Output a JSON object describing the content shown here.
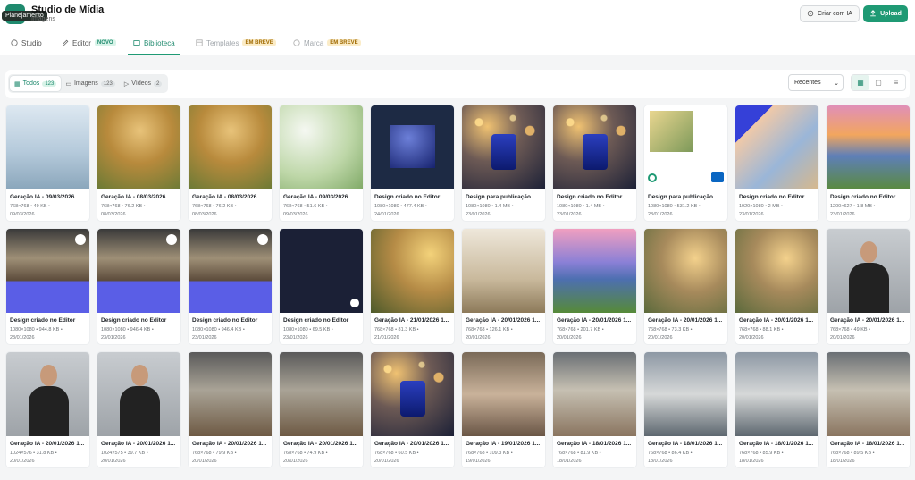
{
  "app": {
    "title": "Studio de Mídia",
    "subtitle": "Imagens",
    "tooltip": "Planejamento"
  },
  "header": {
    "ai_button": "Criar com IA",
    "upload_button": "Upload"
  },
  "tabs": [
    {
      "label": "Studio",
      "icon": "palette-icon",
      "badge": ""
    },
    {
      "label": "Editor",
      "icon": "edit-icon",
      "badge": "NOVO"
    },
    {
      "label": "Biblioteca",
      "icon": "library-icon",
      "badge": ""
    },
    {
      "label": "Templates",
      "icon": "templates-icon",
      "badge": "EM BREVE"
    },
    {
      "label": "Marca",
      "icon": "brand-icon",
      "badge": "EM BREVE"
    }
  ],
  "filters": {
    "all": {
      "label": "Todos",
      "count": "123"
    },
    "images": {
      "label": "Imagens",
      "count": "123"
    },
    "videos": {
      "label": "Vídeos",
      "count": "2"
    },
    "sort": "Recentes"
  },
  "colors": {
    "accent": "#1f9a74",
    "badge_new_bg": "#d8f3e8",
    "badge_soon_bg": "#fbecc8"
  },
  "cards": [
    {
      "title": "Geração IA - 09/03/2026 ...",
      "meta": "768×768 • 49 KB •",
      "date": "09/03/2026",
      "thumb": "t-bottle"
    },
    {
      "title": "Geração IA - 08/03/2026 ...",
      "meta": "768×768 • 76.2 KB •",
      "date": "08/03/2026",
      "thumb": "t-dog"
    },
    {
      "title": "Geração IA - 08/03/2026 ...",
      "meta": "768×768 • 76.2 KB •",
      "date": "08/03/2026",
      "thumb": "t-dog"
    },
    {
      "title": "Geração IA - 09/03/2026 ...",
      "meta": "768×768 • 51.6 KB •",
      "date": "09/03/2026",
      "thumb": "t-perfume-green"
    },
    {
      "title": "Design criado no Editor",
      "meta": "1080×1080 • 477.4 KB •",
      "date": "24/01/2026",
      "thumb": "t-editor-dark"
    },
    {
      "title": "Design para publicação",
      "meta": "1080×1080 • 1.4 MB •",
      "date": "23/01/2026",
      "thumb": "t-perfume-blue"
    },
    {
      "title": "Design criado no Editor",
      "meta": "1080×1080 • 1.4 MB •",
      "date": "23/01/2026",
      "thumb": "t-perfume-blue"
    },
    {
      "title": "Design para publicação",
      "meta": "1080×1080 • 531.2 KB •",
      "date": "23/01/2026",
      "thumb": "t-linkedin"
    },
    {
      "title": "Design criado no Editor",
      "meta": "1920×1080 • 2 MB •",
      "date": "23/01/2026",
      "thumb": "t-beach"
    },
    {
      "title": "Design criado no Editor",
      "meta": "1200×627 • 1.8 MB •",
      "date": "23/01/2026",
      "thumb": "t-house"
    },
    {
      "title": "Design criado no Editor",
      "meta": "1080×1080 • 944.8 KB •",
      "date": "23/01/2026",
      "thumb": "t-lab"
    },
    {
      "title": "Design criado no Editor",
      "meta": "1080×1080 • 946.4 KB •",
      "date": "23/01/2026",
      "thumb": "t-lab"
    },
    {
      "title": "Design criado no Editor",
      "meta": "1080×1080 • 946.4 KB •",
      "date": "23/01/2026",
      "thumb": "t-lab"
    },
    {
      "title": "Design criado no Editor",
      "meta": "1080×1080 • 69.5 KB •",
      "date": "23/01/2026",
      "thumb": "t-lab-dark"
    },
    {
      "title": "Geração IA - 21/01/2026 1...",
      "meta": "768×768 • 81.3 KB •",
      "date": "21/01/2026",
      "thumb": "t-girl-dog"
    },
    {
      "title": "Geração IA - 20/01/2026 1...",
      "meta": "768×768 • 126.1 KB •",
      "date": "20/01/2026",
      "thumb": "t-interior"
    },
    {
      "title": "Geração IA - 20/01/2026 1...",
      "meta": "768×768 • 201.7 KB •",
      "date": "20/01/2026",
      "thumb": "t-house2"
    },
    {
      "title": "Geração IA - 20/01/2026 1...",
      "meta": "768×768 • 73.3 KB •",
      "date": "20/01/2026",
      "thumb": "t-couple"
    },
    {
      "title": "Geração IA - 20/01/2026 1...",
      "meta": "768×768 • 88.1 KB •",
      "date": "20/01/2026",
      "thumb": "t-couple"
    },
    {
      "title": "Geração IA - 20/01/2026 1...",
      "meta": "768×768 • 49 KB •",
      "date": "20/01/2026",
      "thumb": "t-man"
    },
    {
      "title": "Geração IA - 20/01/2026 1...",
      "meta": "1024×576 • 31.8 KB •",
      "date": "20/01/2026",
      "thumb": "t-man"
    },
    {
      "title": "Geração IA - 20/01/2026 1...",
      "meta": "1024×575 • 39.7 KB •",
      "date": "20/01/2026",
      "thumb": "t-man"
    },
    {
      "title": "Geração IA - 20/01/2026 1...",
      "meta": "768×768 • 79.9 KB •",
      "date": "20/01/2026",
      "thumb": "t-office"
    },
    {
      "title": "Geração IA - 20/01/2026 1...",
      "meta": "768×768 • 74.9 KB •",
      "date": "20/01/2026",
      "thumb": "t-office"
    },
    {
      "title": "Geração IA - 20/01/2026 1...",
      "meta": "768×768 • 60.5 KB •",
      "date": "20/01/2026",
      "thumb": "t-perfume-blue"
    },
    {
      "title": "Geração IA - 19/01/2026 1...",
      "meta": "768×768 • 109.3 KB •",
      "date": "19/01/2026",
      "thumb": "t-people"
    },
    {
      "title": "Geração IA - 18/01/2026 1...",
      "meta": "768×768 • 81.9 KB •",
      "date": "18/01/2026",
      "thumb": "t-office2"
    },
    {
      "title": "Geração IA - 18/01/2026 1...",
      "meta": "768×768 • 86.4 KB •",
      "date": "18/01/2026",
      "thumb": "t-laptops"
    },
    {
      "title": "Geração IA - 18/01/2026 1...",
      "meta": "768×768 • 85.9 KB •",
      "date": "18/01/2026",
      "thumb": "t-laptops"
    },
    {
      "title": "Geração IA - 18/01/2026 1...",
      "meta": "768×768 • 89.5 KB •",
      "date": "18/01/2026",
      "thumb": "t-office2"
    }
  ]
}
